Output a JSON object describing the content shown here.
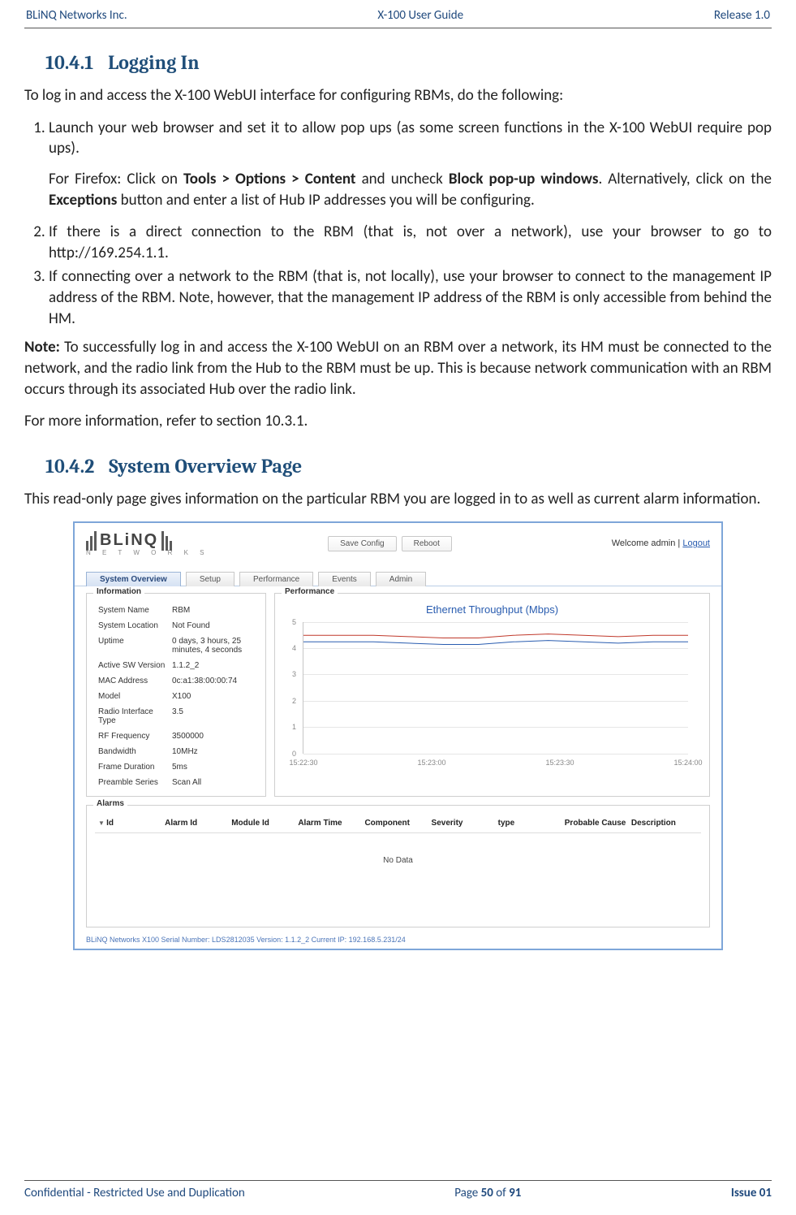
{
  "header": {
    "left": "BLiNQ Networks Inc.",
    "center": "X-100 User Guide",
    "right": "Release 1.0"
  },
  "section1": {
    "number": "10.4.1",
    "title": "Logging In",
    "intro": "To log in and access the X-100 WebUI interface for configuring RBMs, do the following:",
    "step1": "Launch your web browser and set it to allow pop ups (as some screen functions in the X-100 WebUI require pop ups).",
    "step1_sub_pre": "For Firefox: Click on ",
    "step1_sub_b1": "Tools > Options > Content",
    "step1_sub_mid1": " and uncheck ",
    "step1_sub_b2": "Block pop-up windows",
    "step1_sub_mid2": ". Alternatively, click on the ",
    "step1_sub_b3": "Exceptions",
    "step1_sub_post": " button and enter a list of Hub IP addresses you will be configuring.",
    "step2": "If there is a direct connection to the RBM (that is, not over a network), use your browser to go to http://169.254.1.1.",
    "step3": "If connecting over a network to the RBM (that is, not locally), use your browser to connect to the management IP address of the RBM. Note, however, that the management IP address of the RBM is only accessible from behind the HM.",
    "note_label": "Note:",
    "note_body": " To successfully log in and access the X-100 WebUI on an RBM over a network, its HM must be connected to the network, and the radio link from the Hub to the RBM must be up. This is because network communication with an RBM occurs through its associated Hub over the radio link.",
    "more_info": "For more information, refer to section 10.3.1."
  },
  "section2": {
    "number": "10.4.2",
    "title": "System Overview Page",
    "intro": "This read-only page gives information on the particular RBM you are logged in to as well as current alarm information."
  },
  "screenshot": {
    "logo_main": "BLiNQ",
    "logo_sub": "N E T W O R K S",
    "btn_save": "Save Config",
    "btn_reboot": "Reboot",
    "welcome_pre": "Welcome  admin  |  ",
    "logout": "Logout",
    "tabs": [
      "System Overview",
      "Setup",
      "Performance",
      "Events",
      "Admin"
    ],
    "active_tab_index": 0,
    "info_legend": "Information",
    "perf_legend": "Performance",
    "alarms_legend": "Alarms",
    "info": [
      {
        "k": "System Name",
        "v": "RBM"
      },
      {
        "k": "System Location",
        "v": "Not Found"
      },
      {
        "k": "Uptime",
        "v": "0 days, 3 hours, 25 minutes, 4 seconds"
      },
      {
        "k": "Active SW Version",
        "v": "1.1.2_2"
      },
      {
        "k": "MAC Address",
        "v": "0c:a1:38:00:00:74"
      },
      {
        "k": "Model",
        "v": "X100"
      },
      {
        "k": "Radio Interface Type",
        "v": "3.5"
      },
      {
        "k": "RF Frequency",
        "v": "3500000"
      },
      {
        "k": "Bandwidth",
        "v": "10MHz"
      },
      {
        "k": "Frame Duration",
        "v": "5ms"
      },
      {
        "k": "Preamble Series",
        "v": "Scan All"
      }
    ],
    "alarm_cols": [
      "Id",
      "Alarm Id",
      "Module Id",
      "Alarm Time",
      "Component",
      "Severity",
      "type",
      "Probable Cause",
      "Description"
    ],
    "alarm_nodata": "No Data",
    "footer_status": "BLiNQ Networks X100 Serial Number: LDS2812035 Version: 1.1.2_2 Current IP: 192.168.5.231/24"
  },
  "chart_data": {
    "type": "line",
    "title": "Ethernet Throughput (Mbps)",
    "xlabel": "",
    "ylabel": "",
    "ylim": [
      0,
      5
    ],
    "yticks": [
      0,
      1,
      2,
      3,
      4,
      5
    ],
    "xticks": [
      "15:22:30",
      "15:23:00",
      "15:23:30",
      "15:24:00"
    ],
    "series": [
      {
        "name": "series-red",
        "color": "#c0392b",
        "values": [
          4.5,
          4.5,
          4.5,
          4.45,
          4.4,
          4.4,
          4.5,
          4.55,
          4.5,
          4.45,
          4.5,
          4.5
        ]
      },
      {
        "name": "series-blue",
        "color": "#2a5db0",
        "values": [
          4.25,
          4.25,
          4.25,
          4.2,
          4.15,
          4.15,
          4.25,
          4.3,
          4.25,
          4.2,
          4.25,
          4.25
        ]
      }
    ]
  },
  "footer": {
    "left": "Confidential - Restricted Use and Duplication",
    "center_pre": "Page ",
    "center_b1": "50",
    "center_mid": " of ",
    "center_b2": "91",
    "right": "Issue 01"
  }
}
